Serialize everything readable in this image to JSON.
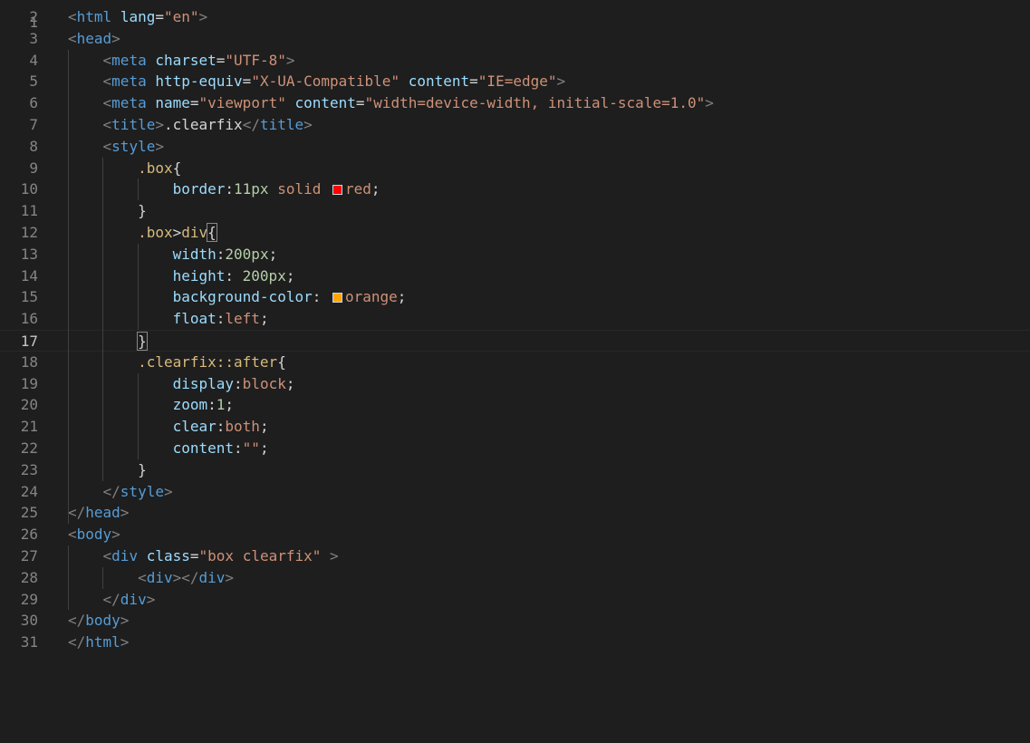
{
  "editor": {
    "colors": {
      "background": "#1e1e1e",
      "punct": "#808080",
      "tag": "#569cd6",
      "attr": "#9cdcfe",
      "string": "#ce9178",
      "selector": "#d7ba7d",
      "number": "#b5cea8",
      "text": "#d4d4d4"
    },
    "active_line": "17",
    "swatches": {
      "red": "#ff0000",
      "orange": "#ffa500"
    },
    "lines": [
      {
        "no": "2",
        "tokens": [
          [
            "<",
            "p"
          ],
          [
            "html",
            "t"
          ],
          [
            " ",
            "x"
          ],
          [
            "lang",
            "a"
          ],
          [
            "=",
            "x"
          ],
          [
            "\"en\"",
            "s"
          ],
          [
            ">",
            "p"
          ]
        ]
      },
      {
        "no": "3",
        "tokens": [
          [
            "<",
            "p"
          ],
          [
            "head",
            "t"
          ],
          [
            ">",
            "p"
          ]
        ]
      },
      {
        "no": "4",
        "tokens": [
          [
            "    ",
            "x"
          ],
          [
            "<",
            "p"
          ],
          [
            "meta",
            "t"
          ],
          [
            " ",
            "x"
          ],
          [
            "charset",
            "a"
          ],
          [
            "=",
            "x"
          ],
          [
            "\"UTF-8\"",
            "s"
          ],
          [
            ">",
            "p"
          ]
        ]
      },
      {
        "no": "5",
        "tokens": [
          [
            "    ",
            "x"
          ],
          [
            "<",
            "p"
          ],
          [
            "meta",
            "t"
          ],
          [
            " ",
            "x"
          ],
          [
            "http-equiv",
            "a"
          ],
          [
            "=",
            "x"
          ],
          [
            "\"X-UA-Compatible\"",
            "s"
          ],
          [
            " ",
            "x"
          ],
          [
            "content",
            "a"
          ],
          [
            "=",
            "x"
          ],
          [
            "\"IE=edge\"",
            "s"
          ],
          [
            ">",
            "p"
          ]
        ]
      },
      {
        "no": "6",
        "tokens": [
          [
            "    ",
            "x"
          ],
          [
            "<",
            "p"
          ],
          [
            "meta",
            "t"
          ],
          [
            " ",
            "x"
          ],
          [
            "name",
            "a"
          ],
          [
            "=",
            "x"
          ],
          [
            "\"viewport\"",
            "s"
          ],
          [
            " ",
            "x"
          ],
          [
            "content",
            "a"
          ],
          [
            "=",
            "x"
          ],
          [
            "\"width=device-width, initial-scale=1.0\"",
            "s"
          ],
          [
            ">",
            "p"
          ]
        ]
      },
      {
        "no": "7",
        "tokens": [
          [
            "    ",
            "x"
          ],
          [
            "<",
            "p"
          ],
          [
            "title",
            "t"
          ],
          [
            ">",
            "p"
          ],
          [
            ".clearfix",
            "x"
          ],
          [
            "</",
            "p"
          ],
          [
            "title",
            "t"
          ],
          [
            ">",
            "p"
          ]
        ]
      },
      {
        "no": "8",
        "tokens": [
          [
            "    ",
            "x"
          ],
          [
            "<",
            "p"
          ],
          [
            "style",
            "t"
          ],
          [
            ">",
            "p"
          ]
        ]
      },
      {
        "no": "9",
        "tokens": [
          [
            "        ",
            "x"
          ],
          [
            ".box",
            "sel"
          ],
          [
            "{",
            "x"
          ]
        ]
      },
      {
        "no": "10",
        "tokens": [
          [
            "            ",
            "x"
          ],
          [
            "border",
            "a"
          ],
          [
            ":",
            "x"
          ],
          [
            "11px",
            "n"
          ],
          [
            " ",
            "x"
          ],
          [
            "solid",
            "s"
          ],
          [
            " ",
            "x"
          ],
          [
            "swatch-red",
            "sw"
          ],
          [
            "red",
            "s"
          ],
          [
            ";",
            "x"
          ]
        ]
      },
      {
        "no": "11",
        "tokens": [
          [
            "        ",
            "x"
          ],
          [
            "}",
            "x"
          ]
        ]
      },
      {
        "no": "12",
        "tokens": [
          [
            "        ",
            "x"
          ],
          [
            ".box",
            "sel"
          ],
          [
            ">",
            "x"
          ],
          [
            "div",
            "sel"
          ],
          [
            "{",
            "hl"
          ]
        ]
      },
      {
        "no": "13",
        "tokens": [
          [
            "            ",
            "x"
          ],
          [
            "width",
            "a"
          ],
          [
            ":",
            "x"
          ],
          [
            "200px",
            "n"
          ],
          [
            ";",
            "x"
          ]
        ]
      },
      {
        "no": "14",
        "tokens": [
          [
            "            ",
            "x"
          ],
          [
            "height",
            "a"
          ],
          [
            ": ",
            "x"
          ],
          [
            "200px",
            "n"
          ],
          [
            ";",
            "x"
          ]
        ]
      },
      {
        "no": "15",
        "tokens": [
          [
            "            ",
            "x"
          ],
          [
            "background-color",
            "a"
          ],
          [
            ": ",
            "x"
          ],
          [
            "swatch-orange",
            "sw"
          ],
          [
            "orange",
            "s"
          ],
          [
            ";",
            "x"
          ]
        ]
      },
      {
        "no": "16",
        "tokens": [
          [
            "            ",
            "x"
          ],
          [
            "float",
            "a"
          ],
          [
            ":",
            "x"
          ],
          [
            "left",
            "s"
          ],
          [
            ";",
            "x"
          ]
        ]
      },
      {
        "no": "17",
        "tokens": [
          [
            "        ",
            "x"
          ],
          [
            "}",
            "hl"
          ]
        ]
      },
      {
        "no": "18",
        "tokens": [
          [
            "        ",
            "x"
          ],
          [
            ".clearfix::after",
            "sel"
          ],
          [
            "{",
            "x"
          ]
        ]
      },
      {
        "no": "19",
        "tokens": [
          [
            "            ",
            "x"
          ],
          [
            "display",
            "a"
          ],
          [
            ":",
            "x"
          ],
          [
            "block",
            "s"
          ],
          [
            ";",
            "x"
          ]
        ]
      },
      {
        "no": "20",
        "tokens": [
          [
            "            ",
            "x"
          ],
          [
            "zoom",
            "a"
          ],
          [
            ":",
            "x"
          ],
          [
            "1",
            "n"
          ],
          [
            ";",
            "x"
          ]
        ]
      },
      {
        "no": "21",
        "tokens": [
          [
            "            ",
            "x"
          ],
          [
            "clear",
            "a"
          ],
          [
            ":",
            "x"
          ],
          [
            "both",
            "s"
          ],
          [
            ";",
            "x"
          ]
        ]
      },
      {
        "no": "22",
        "tokens": [
          [
            "            ",
            "x"
          ],
          [
            "content",
            "a"
          ],
          [
            ":",
            "x"
          ],
          [
            "\"\"",
            "s"
          ],
          [
            ";",
            "x"
          ]
        ]
      },
      {
        "no": "23",
        "tokens": [
          [
            "        ",
            "x"
          ],
          [
            "}",
            "x"
          ]
        ]
      },
      {
        "no": "24",
        "tokens": [
          [
            "    ",
            "x"
          ],
          [
            "</",
            "p"
          ],
          [
            "style",
            "t"
          ],
          [
            ">",
            "p"
          ]
        ]
      },
      {
        "no": "25",
        "tokens": [
          [
            "</",
            "p"
          ],
          [
            "head",
            "t"
          ],
          [
            ">",
            "p"
          ]
        ]
      },
      {
        "no": "26",
        "tokens": [
          [
            "<",
            "p"
          ],
          [
            "body",
            "t"
          ],
          [
            ">",
            "p"
          ]
        ]
      },
      {
        "no": "27",
        "tokens": [
          [
            "    ",
            "x"
          ],
          [
            "<",
            "p"
          ],
          [
            "div",
            "t"
          ],
          [
            " ",
            "x"
          ],
          [
            "class",
            "a"
          ],
          [
            "=",
            "x"
          ],
          [
            "\"box clearfix\"",
            "s"
          ],
          [
            " ",
            "x"
          ],
          [
            ">",
            "p"
          ]
        ]
      },
      {
        "no": "28",
        "tokens": [
          [
            "        ",
            "x"
          ],
          [
            "<",
            "p"
          ],
          [
            "div",
            "t"
          ],
          [
            "></",
            "p"
          ],
          [
            "div",
            "t"
          ],
          [
            ">",
            "p"
          ]
        ]
      },
      {
        "no": "29",
        "tokens": [
          [
            "    ",
            "x"
          ],
          [
            "</",
            "p"
          ],
          [
            "div",
            "t"
          ],
          [
            ">",
            "p"
          ]
        ]
      },
      {
        "no": "30",
        "tokens": [
          [
            "</",
            "p"
          ],
          [
            "body",
            "t"
          ],
          [
            ">",
            "p"
          ]
        ]
      },
      {
        "no": "31",
        "tokens": [
          [
            "</",
            "p"
          ],
          [
            "html",
            "t"
          ],
          [
            ">",
            "p"
          ]
        ]
      }
    ]
  }
}
